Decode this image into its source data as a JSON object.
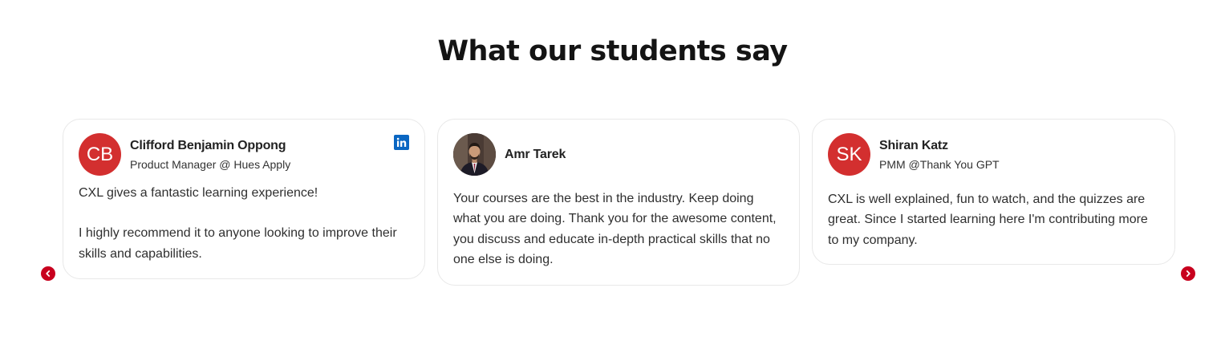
{
  "section": {
    "title": "What our students say"
  },
  "testimonials": [
    {
      "initials": "CB",
      "name": "Clifford Benjamin Oppong",
      "role": "Product Manager @ Hues Apply",
      "paragraphs": [
        "CXL gives a fantastic learning experience!",
        "I highly recommend it to anyone looking to improve their skills and capabilities."
      ],
      "source_icon": "linkedin-icon"
    },
    {
      "name": "Amr Tarek",
      "avatar_icon": "person-photo",
      "paragraphs": [
        "Your courses are the best in the industry. Keep doing what you are doing. Thank you for the awesome content, you discuss and educate in-depth practical skills that no one else is doing."
      ]
    },
    {
      "initials": "SK",
      "name": "Shiran Katz",
      "role": "PMM @Thank You GPT",
      "paragraphs": [
        "CXL is well explained, fun to watch, and the quizzes are great. Since I started learning here I'm contributing more to my company."
      ]
    }
  ],
  "navigation": {
    "prev_icon": "chevron-left-icon",
    "next_icon": "chevron-right-icon"
  },
  "colors": {
    "accent": "#c8001e",
    "avatar_bg": "#d32f2f",
    "linkedin": "#0a66c2",
    "title": "#141414"
  }
}
